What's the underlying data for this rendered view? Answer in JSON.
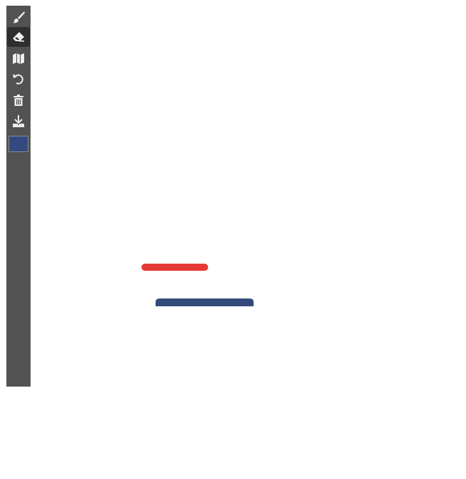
{
  "toolbar": {
    "tools": [
      {
        "name": "brush",
        "icon": "brush-icon",
        "active": false
      },
      {
        "name": "eraser",
        "icon": "eraser-icon",
        "active": true
      },
      {
        "name": "map",
        "icon": "map-icon",
        "active": false
      },
      {
        "name": "undo",
        "icon": "undo-icon",
        "active": false
      },
      {
        "name": "clear",
        "icon": "trash-icon",
        "active": false
      },
      {
        "name": "download",
        "icon": "download-icon",
        "active": false
      }
    ],
    "current_color": "#34497f"
  },
  "strokes": [
    {
      "color": "#e53935"
    },
    {
      "color": "#344a7a"
    }
  ]
}
